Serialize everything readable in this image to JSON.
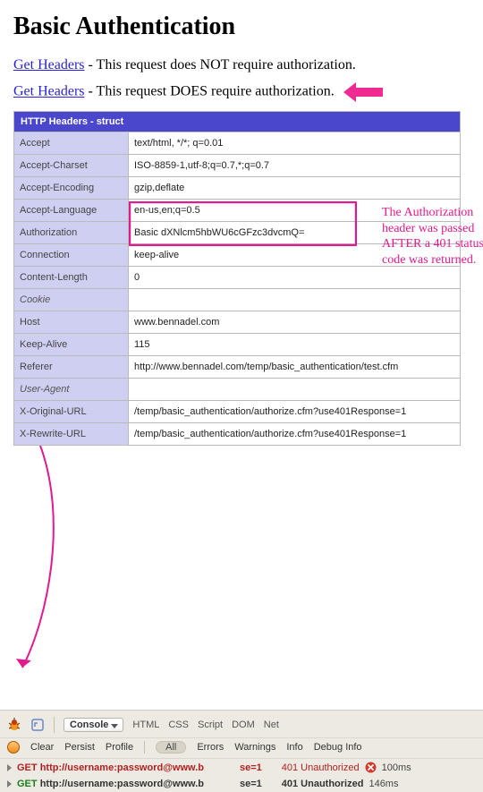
{
  "heading": "Basic Authentication",
  "line1": {
    "link": "Get Headers",
    "text": " - This request does NOT require authorization."
  },
  "line2": {
    "link": "Get Headers",
    "text": " - This request DOES require authorization."
  },
  "table": {
    "title": "HTTP Headers - struct",
    "rows": [
      {
        "k": "Accept",
        "v": "text/html, */*; q=0.01"
      },
      {
        "k": "Accept-Charset",
        "v": "ISO-8859-1,utf-8;q=0.7,*;q=0.7"
      },
      {
        "k": "Accept-Encoding",
        "v": "gzip,deflate"
      },
      {
        "k": "Accept-Language",
        "v": "en-us,en;q=0.5"
      },
      {
        "k": "Authorization",
        "v": "Basic dXNlcm5hbWU6cGFzc3dvcmQ="
      },
      {
        "k": "Connection",
        "v": "keep-alive"
      },
      {
        "k": "Content-Length",
        "v": "0"
      },
      {
        "k": "Cookie",
        "v": "",
        "it": true
      },
      {
        "k": "Host",
        "v": "www.bennadel.com"
      },
      {
        "k": "Keep-Alive",
        "v": "115"
      },
      {
        "k": "Referer",
        "v": "http://www.bennadel.com/temp/basic_authentication/test.cfm"
      },
      {
        "k": "User-Agent",
        "v": "",
        "it": true
      },
      {
        "k": "X-Original-URL",
        "v": "/temp/basic_authentication/authorize.cfm?use401Response=1"
      },
      {
        "k": "X-Rewrite-URL",
        "v": "/temp/basic_authentication/authorize.cfm?use401Response=1"
      }
    ]
  },
  "annotation": "The Authorization header was passed AFTER a 401 status code was returned.",
  "devtools": {
    "consoleLabel": "Console",
    "tabs": [
      "HTML",
      "CSS",
      "Script",
      "DOM",
      "Net"
    ],
    "row2": {
      "clear": "Clear",
      "persist": "Persist",
      "profile": "Profile",
      "all": "All",
      "errors": "Errors",
      "warnings": "Warnings",
      "info": "Info",
      "debugInfo": "Debug Info"
    },
    "req1": {
      "method": "GET",
      "urlA": "http://username:password@www.b",
      "urlB": "se=1",
      "status": "401 Unauthorized",
      "ms": "100ms"
    },
    "req2": {
      "method": "GET",
      "urlA": "http://username:password@www.b",
      "urlB": "se=1",
      "status": "401 Unauthorized",
      "ms": "146ms"
    }
  }
}
